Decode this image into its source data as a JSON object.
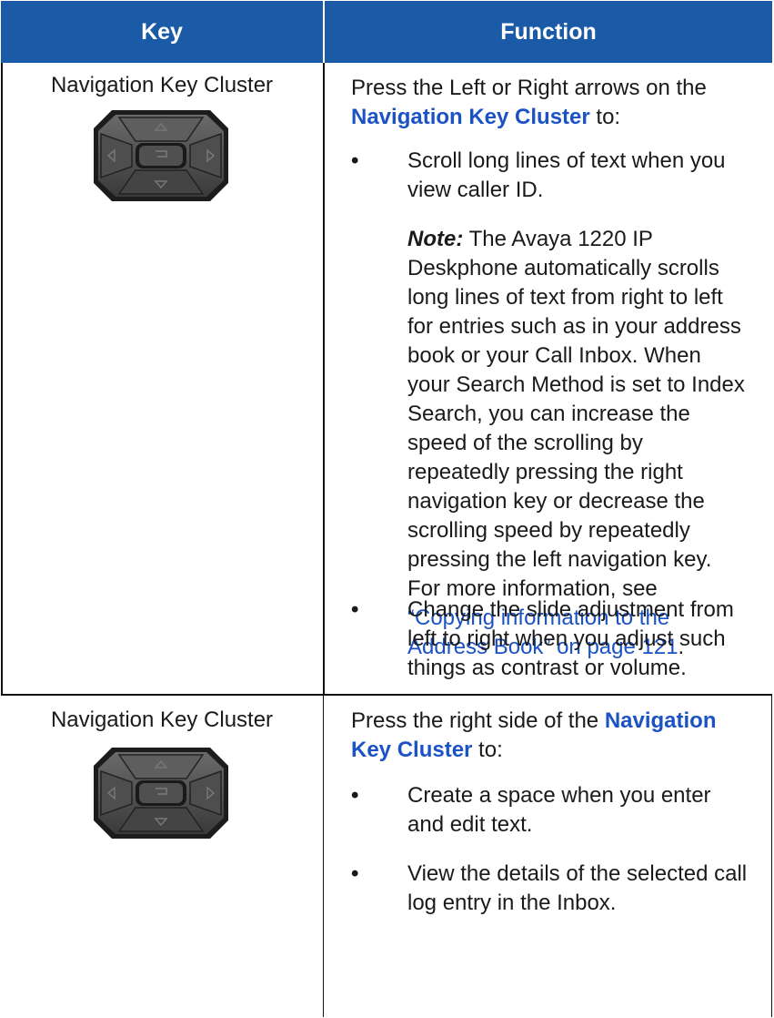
{
  "header": {
    "key": "Key",
    "function": "Function"
  },
  "rows": [
    {
      "key_label": "Navigation Key Cluster",
      "key_icon": "navigation-key-cluster-icon",
      "intro_before": "Press the Left or Right arrows on the ",
      "intro_link": "Navigation Key Cluster",
      "intro_after": " to:",
      "bullets": [
        {
          "line1": "Scroll long lines of text when you",
          "line2": "view caller ID."
        },
        {
          "line1": "Change the slide adjustment from",
          "line2": "left to right when you adjust such",
          "line3": "things as contrast or volume."
        }
      ],
      "note": {
        "label": "Note:",
        "lines": [
          "The Avaya 1220 IP",
          "Deskphone automatically scrolls",
          "long lines of text from right to left",
          "for entries such as in your address",
          "book or your Call Inbox. When",
          "your Search Method is set to Index",
          "Search, you can increase the",
          "speed of the scrolling by",
          "repeatedly pressing the right",
          "navigation key or decrease the",
          "scrolling speed by repeatedly",
          "pressing the left navigation key.",
          "For more information, see"
        ],
        "link_line1": "“Copying information to the",
        "link_line2": "Address Book” on page 121",
        "link_end": "."
      }
    },
    {
      "key_label": "Navigation Key Cluster",
      "key_icon": "navigation-key-cluster-icon",
      "intro_before": "Press the right side of the ",
      "intro_link1": "Navigation",
      "intro_link2": "Key Cluster",
      "intro_after": " to:",
      "bullets": [
        {
          "line1": "Create a space when you enter",
          "line2": "and edit text."
        },
        {
          "line1": "View the details of the selected call",
          "line2": "log entry in the Inbox."
        }
      ]
    }
  ],
  "colors": {
    "header_bg": "#1a5aa6",
    "link": "#1b52c4"
  }
}
